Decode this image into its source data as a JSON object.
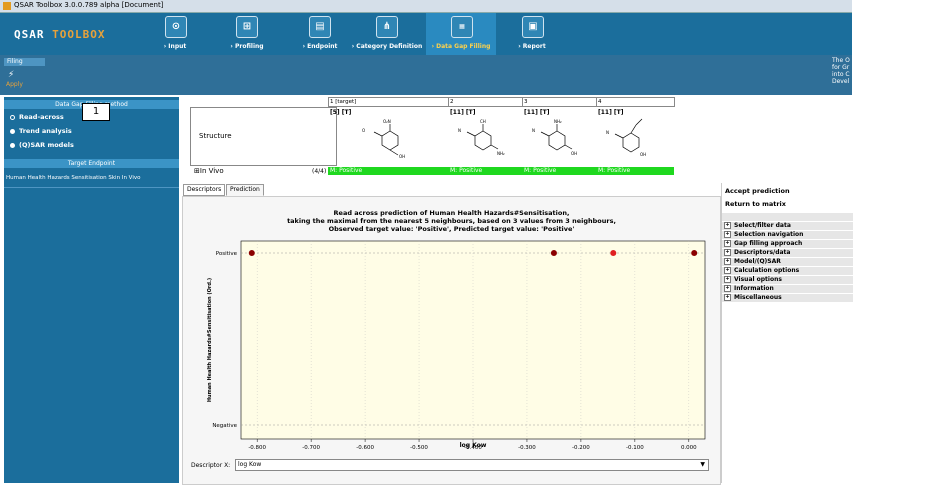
{
  "window": {
    "title": "QSAR Toolbox 3.0.0.789 alpha [Document]"
  },
  "brand": {
    "part1": "QSAR",
    "part2": "TOOLBOX"
  },
  "nav": [
    {
      "label": "› Input",
      "icon": "input-icon"
    },
    {
      "label": "› Profiling",
      "icon": "profiling-icon"
    },
    {
      "label": "› Endpoint",
      "icon": "endpoint-icon"
    },
    {
      "label": "› Category Definition",
      "icon": "category-icon"
    },
    {
      "label": "› Data Gap Filling",
      "icon": "data-gap-icon"
    },
    {
      "label": "› Report",
      "icon": "report-icon"
    }
  ],
  "subbar": {
    "tab": "Filing",
    "apply": "Apply",
    "note": "The O for Gr into C Devel"
  },
  "leftpanel": {
    "method_header": "Data Gap Filling method",
    "methods": [
      "Read-across",
      "Trend analysis",
      "(Q)SAR models"
    ],
    "target_header": "Target Endpoint",
    "target_text": "Human Health Hazards Sensitisation Skin In Vivo",
    "callout": "1"
  },
  "matrix": {
    "columns": [
      {
        "header": "1 [target]",
        "sub": "[5] [T]"
      },
      {
        "header": "2",
        "sub": "[11] [T]"
      },
      {
        "header": "3",
        "sub": "[11] [T]"
      },
      {
        "header": "4",
        "sub": "[11] [T]"
      }
    ],
    "row_label": "Structure",
    "invivo": "In Vivo",
    "invivo_count": "(4/4)",
    "values": [
      "M: Positive",
      "M: Positive",
      "M: Positive",
      "M: Positive"
    ]
  },
  "tabs": [
    "Descriptors",
    "Prediction"
  ],
  "chart_data": {
    "type": "scatter",
    "title_lines": [
      "Read across prediction of Human Health Hazards#Sensitisation,",
      "taking the maximal from the nearest 5 neighbours, based on 3 values from 3 neighbours,",
      "Observed target value: 'Positive', Predicted target value: 'Positive'"
    ],
    "xlabel": "log Kow",
    "ylabel": "Human Health Hazards#Sensitisation (Ord.)",
    "y_categories": [
      "Negative",
      "Positive"
    ],
    "x_ticks": [
      "-0.800",
      "-0.700",
      "-0.600",
      "-0.500",
      "-0.400",
      "-0.300",
      "-0.200",
      "-0.100",
      "0.000"
    ],
    "xlim": [
      -0.83,
      0.03
    ],
    "points": [
      {
        "x": -0.81,
        "y": "Positive",
        "color": "#8b0000"
      },
      {
        "x": -0.25,
        "y": "Positive",
        "color": "#8b0000"
      },
      {
        "x": -0.14,
        "y": "Positive",
        "color": "#e02020"
      },
      {
        "x": 0.01,
        "y": "Positive",
        "color": "#8b0000"
      }
    ],
    "grid": true
  },
  "descriptor": {
    "label": "Descriptor X:",
    "value": "log Kow"
  },
  "rightpanel": {
    "buttons": [
      "Accept prediction",
      "Return to matrix"
    ],
    "sections": [
      "Select/filter data",
      "Selection navigation",
      "Gap filling approach",
      "Descriptors/data",
      "Model/(Q)SAR",
      "Calculation options",
      "Visual options",
      "Information",
      "Miscellaneous"
    ]
  }
}
